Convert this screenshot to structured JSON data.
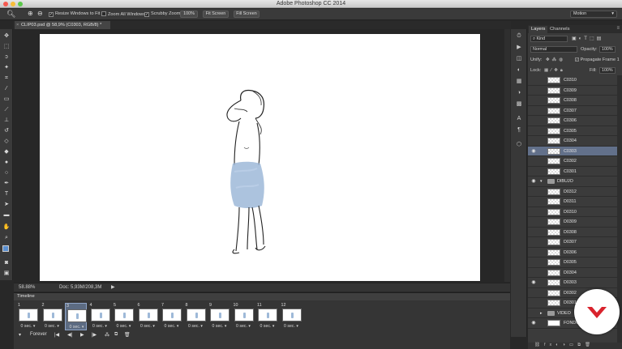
{
  "app": {
    "title": "Adobe Photoshop CC 2014",
    "traffic_lights": [
      "#f5594f",
      "#f7bd3a",
      "#5bc84a"
    ]
  },
  "options_bar": {
    "resize_windows": "Resize Windows to Fit",
    "zoom_all_windows": "Zoom All Windows",
    "scrubby_zoom": "Scrubby Zoom",
    "zoom_percent": "100%",
    "fit_screen": "Fit Screen",
    "fill_screen": "Fill Screen",
    "workspace": "Motion"
  },
  "document_tab": {
    "label": "CLIP03.psd @ 58,9% (C0303, RGB/8) *"
  },
  "status_bar": {
    "zoom": "58.88%",
    "doc_size": "Doc: 5,93M/208,3M"
  },
  "timeline": {
    "title": "Timeline",
    "frames": [
      {
        "num": "1",
        "delay": "0 sec."
      },
      {
        "num": "2",
        "delay": "0 sec."
      },
      {
        "num": "3",
        "delay": "0 sec."
      },
      {
        "num": "4",
        "delay": "0 sec."
      },
      {
        "num": "5",
        "delay": "0 sec."
      },
      {
        "num": "6",
        "delay": "0 sec."
      },
      {
        "num": "7",
        "delay": "0 sec."
      },
      {
        "num": "8",
        "delay": "0 sec."
      },
      {
        "num": "9",
        "delay": "0 sec."
      },
      {
        "num": "10",
        "delay": "0 sec."
      },
      {
        "num": "11",
        "delay": "0 sec."
      },
      {
        "num": "12",
        "delay": "0 sec."
      }
    ],
    "selected_frame": "3",
    "loop": "Forever"
  },
  "layers_panel": {
    "tabs": [
      "Layers",
      "Channels"
    ],
    "kind_filter": "Kind",
    "blend_mode": "Normal",
    "opacity_label": "Opacity:",
    "opacity_value": "100%",
    "unify_label": "Unify:",
    "propagate": "Propagate Frame 1",
    "lock_label": "Lock:",
    "fill_label": "Fill:",
    "fill_value": "100%",
    "layers": [
      {
        "name": "C0310",
        "type": "layer",
        "visible": false
      },
      {
        "name": "C0309",
        "type": "layer",
        "visible": false
      },
      {
        "name": "C0308",
        "type": "layer",
        "visible": false
      },
      {
        "name": "C0307",
        "type": "layer",
        "visible": false
      },
      {
        "name": "C0306",
        "type": "layer",
        "visible": false
      },
      {
        "name": "C0305",
        "type": "layer",
        "visible": false
      },
      {
        "name": "C0304",
        "type": "layer",
        "visible": false
      },
      {
        "name": "C0303",
        "type": "layer",
        "visible": true,
        "selected": true
      },
      {
        "name": "C0302",
        "type": "layer",
        "visible": false
      },
      {
        "name": "C0301",
        "type": "layer",
        "visible": false
      },
      {
        "name": "DIBUJO",
        "type": "group",
        "visible": true
      },
      {
        "name": "D0312",
        "type": "layer",
        "visible": false
      },
      {
        "name": "D0311",
        "type": "layer",
        "visible": false
      },
      {
        "name": "D0310",
        "type": "layer",
        "visible": false
      },
      {
        "name": "D0309",
        "type": "layer",
        "visible": false
      },
      {
        "name": "D0308",
        "type": "layer",
        "visible": false
      },
      {
        "name": "D0307",
        "type": "layer",
        "visible": false
      },
      {
        "name": "D0306",
        "type": "layer",
        "visible": false
      },
      {
        "name": "D0305",
        "type": "layer",
        "visible": false
      },
      {
        "name": "D0304",
        "type": "layer",
        "visible": false
      },
      {
        "name": "D0303",
        "type": "layer",
        "visible": true
      },
      {
        "name": "D0302",
        "type": "layer",
        "visible": false
      },
      {
        "name": "D0301",
        "type": "layer",
        "visible": false
      },
      {
        "name": "VIDEO",
        "type": "group",
        "visible": false
      },
      {
        "name": "FONDO",
        "type": "layer",
        "visible": true
      }
    ]
  },
  "colors": {
    "selection": "#62708a",
    "shorts_blue": "#9eb9d8",
    "badge_red": "#d9232d"
  }
}
